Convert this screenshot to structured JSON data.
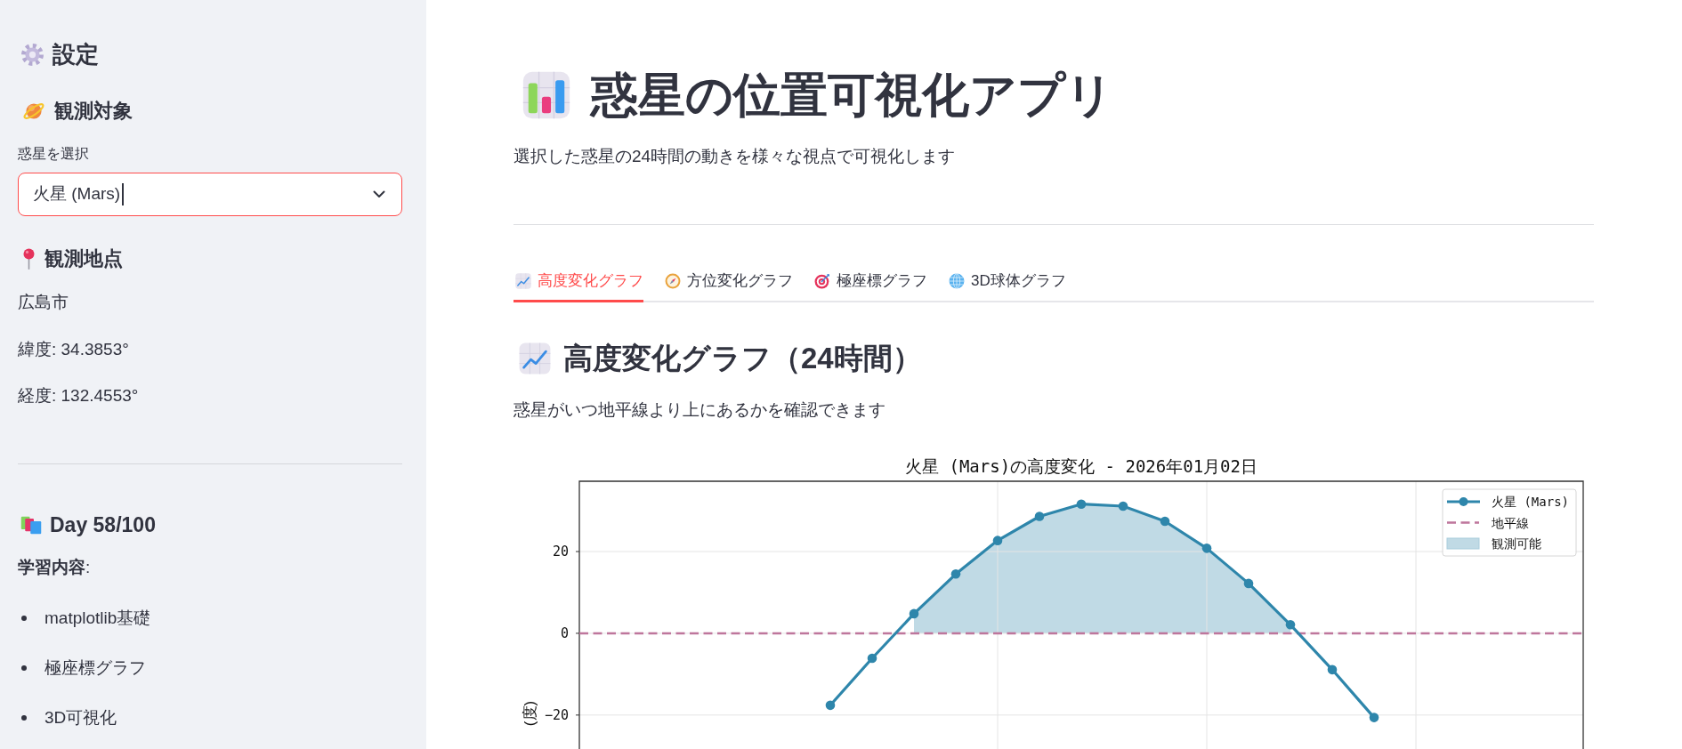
{
  "sidebar": {
    "title": "設定",
    "target": {
      "heading": "観測対象",
      "select": {
        "label": "惑星を選択",
        "value": "火星 (Mars)",
        "focused": true
      }
    },
    "location": {
      "heading": "観測地点",
      "lines": [
        "広島市",
        "緯度: 34.3853°",
        "経度: 132.4553°"
      ]
    },
    "progress": {
      "heading": "Day 58/100",
      "subheading": "**学習内容**:",
      "items": [
        "matplotlib基礎",
        "極座標グラフ",
        "3D可視化"
      ]
    }
  },
  "main": {
    "title": "惑星の位置可視化アプリ",
    "subtitle": "選択した惑星の24時間の動きを様々な視点で可視化します",
    "tabs": [
      {
        "label": "高度変化グラフ",
        "selected": true
      },
      {
        "label": "方位変化グラフ",
        "selected": false
      },
      {
        "label": "極座標グラフ",
        "selected": false
      },
      {
        "label": "3D球体グラフ",
        "selected": false
      }
    ],
    "section": {
      "heading": "高度変化グラフ（24時間）",
      "caption": "惑星がいつ地平線より上にあるかを確認できます",
      "chart_data": {
        "type": "line",
        "title": "火星 (Mars)の高度変化 - 2026年01月02日",
        "ylabel": "(度)",
        "categories": [
          null,
          null,
          null,
          null,
          null,
          null,
          null,
          null,
          null,
          null,
          null,
          null,
          null,
          null
        ],
        "ylim": [
          -28.3,
          37.2
        ],
        "yticks": [
          {
            "value": -20,
            "label": "−20"
          },
          0,
          20
        ],
        "grid": true,
        "legend": "upper right",
        "series": [
          {
            "name": "火星 (Mars)",
            "color": "#2e86ab",
            "marker": "o",
            "values": [
              -17.6,
              -6.1,
              4.8,
              14.5,
              22.7,
              28.6,
              31.6,
              31.1,
              27.4,
              20.8,
              12.2,
              2.1,
              -8.9,
              -20.6
            ]
          },
          {
            "name": "観測可能",
            "type": "area",
            "color": "#c0dae5",
            "values": [
              null,
              null,
              4.8,
              14.5,
              22.7,
              28.6,
              31.6,
              31.1,
              27.4,
              20.8,
              12.2,
              2.1,
              null,
              null
            ]
          }
        ],
        "ref_lines": [
          {
            "axis": "y",
            "value": 0,
            "label": "地平線",
            "color": "#be769c"
          }
        ]
      }
    }
  }
}
